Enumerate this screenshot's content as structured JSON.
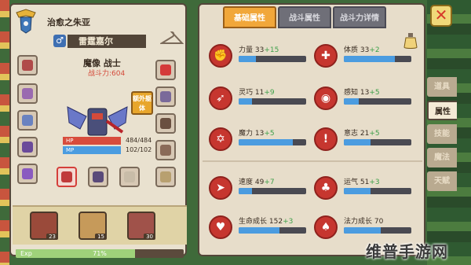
{
  "colors": {
    "accent_tab": "#f1a73a",
    "hp": "#d84c3c",
    "mp": "#4b9ce0",
    "stat_bar": "#4b9ce0",
    "bonus_text": "#3ea04a",
    "power_text": "#d44a3a",
    "exp": "#9fd27a"
  },
  "character": {
    "guild_name": "治愈之朱亚",
    "gender_icon": "♂",
    "name": "雷霆嘉尔",
    "title": "魔像 战士",
    "power_label": "战斗力:604",
    "extra_badge": "额外躯体",
    "hp": {
      "label": "HP",
      "value": "484/484",
      "ratio": 1.0
    },
    "mp": {
      "label": "MP",
      "value": "102/102",
      "ratio": 1.0
    },
    "skills": [
      {
        "level": "23"
      },
      {
        "level": "15"
      },
      {
        "level": "30"
      }
    ],
    "exp": {
      "label": "Exp",
      "percent": "71%",
      "ratio": 0.71
    }
  },
  "tabs": [
    {
      "label": "基础属性",
      "active": true
    },
    {
      "label": "战斗属性",
      "active": false
    },
    {
      "label": "战斗力详情",
      "active": false
    }
  ],
  "stats": [
    {
      "name": "力量",
      "base": "33",
      "bonus": "+15",
      "ratio": 0.25,
      "icon": "arm-icon",
      "glyph": "✊"
    },
    {
      "name": "体质",
      "base": "33",
      "bonus": "+2",
      "ratio": 0.75,
      "icon": "shield-icon",
      "glyph": "✚"
    },
    {
      "name": "灵巧",
      "base": "11",
      "bonus": "+9",
      "ratio": 0.2,
      "icon": "run-icon",
      "glyph": "➶"
    },
    {
      "name": "感知",
      "base": "13",
      "bonus": "+5",
      "ratio": 0.22,
      "icon": "eye-icon",
      "glyph": "◉"
    },
    {
      "name": "魔力",
      "base": "13",
      "bonus": "+5",
      "ratio": 0.8,
      "icon": "hexagram-icon",
      "glyph": "✡"
    },
    {
      "name": "意志",
      "base": "21",
      "bonus": "+5",
      "ratio": 0.4,
      "icon": "will-icon",
      "glyph": "!"
    },
    {
      "name": "速度",
      "base": "49",
      "bonus": "+7",
      "ratio": 0.2,
      "icon": "wing-icon",
      "glyph": "➤"
    },
    {
      "name": "运气",
      "base": "51",
      "bonus": "+3",
      "ratio": 0.4,
      "icon": "clover-icon",
      "glyph": "♣"
    },
    {
      "name": "生命成长",
      "base": "152",
      "bonus": "+3",
      "ratio": 0.6,
      "icon": "heart-icon",
      "glyph": "♥"
    },
    {
      "name": "法力成长",
      "base": "70",
      "bonus": "",
      "ratio": 0.55,
      "icon": "tree-icon",
      "glyph": "♠"
    }
  ],
  "side_menu": [
    {
      "label": "道具",
      "active": false
    },
    {
      "label": "属性",
      "active": true
    },
    {
      "label": "技能",
      "active": false
    },
    {
      "label": "魔法",
      "active": false
    },
    {
      "label": "天赋",
      "active": false
    }
  ],
  "close_label": "✕",
  "watermark": "维普手游网"
}
